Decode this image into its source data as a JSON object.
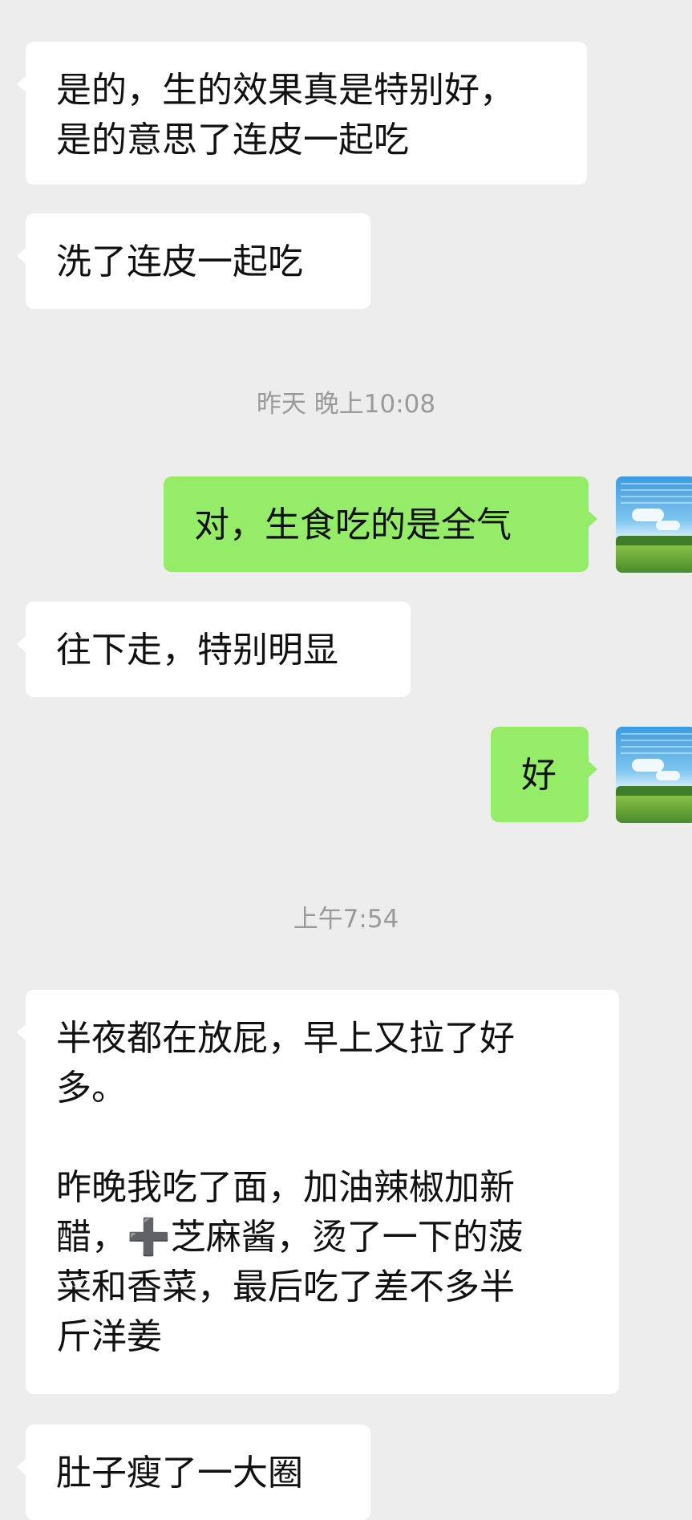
{
  "messages": [
    {
      "text": "是的，生的效果真是特别好，\n是的意思了连皮一起吃"
    },
    {
      "text": "洗了连皮一起吃"
    },
    {
      "text": "对，生食吃的是全气"
    },
    {
      "text": "往下走，特别明显"
    },
    {
      "text": "好"
    },
    {
      "text": "半夜都在放屁，早上又拉了好\n多。\n\n昨晚我吃了面，加油辣椒加新\n醋，➕芝麻酱，烫了一下的菠\n菜和香菜，最后吃了差不多半\n斤洋姜"
    },
    {
      "text": "肚子瘦了一大圈"
    }
  ],
  "timestamps": [
    {
      "text": "昨天 晚上10:08"
    },
    {
      "text": "上午7:54"
    }
  ],
  "avatar": {
    "icon": "landscape-avatar-icon"
  },
  "colors": {
    "background": "#ededed",
    "incoming_bubble": "#ffffff",
    "outgoing_bubble": "#95ec69",
    "timestamp_text": "#9a9a9a"
  }
}
